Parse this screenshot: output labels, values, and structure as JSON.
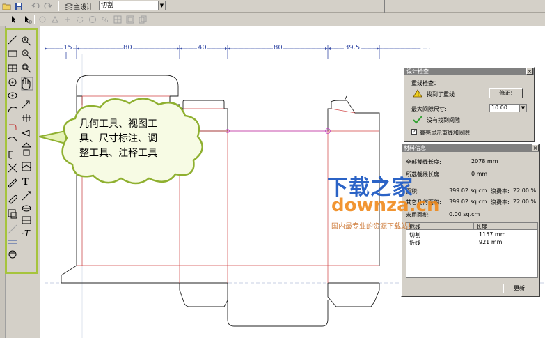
{
  "toolbar": {
    "main_design_label": "主设计",
    "layer_select_value": "切割"
  },
  "canvas": {
    "dimensions": [
      "15",
      "80",
      "40",
      "80",
      "39.5"
    ]
  },
  "callout": {
    "text": "几何工具、视图工具、尺寸标注、调整工具、注释工具",
    "lines": [
      "几何工具、视图工",
      "具、尺寸标注、调",
      "整工具、注释工具"
    ]
  },
  "design_check": {
    "title": "设计检查",
    "overlap_label": "重线检查：",
    "overlap_status": "找到了重线",
    "fix_button": "修正!",
    "max_gap_label": "最大间隙尺寸:",
    "max_gap_value": "10.00",
    "gap_status": "没有找到间隙",
    "highlight_checkbox_label": "高亮显示重线和间隙",
    "highlight_checked": true
  },
  "material_info": {
    "title": "材料信息",
    "rows": [
      {
        "label": "全部截线长度:",
        "value": "2078 mm"
      },
      {
        "label": "所选截线长度:",
        "value": "0 mm"
      },
      {
        "label": "面积:",
        "value": "399.02 sq.cm",
        "label2": "浪费率:",
        "value2": "22.00 %"
      },
      {
        "label": "其它几何面积:",
        "value": "399.02 sq.cm",
        "label2": "浪费率:",
        "value2": "22.00 %"
      },
      {
        "label": "未用面积:",
        "value": "0.00 sq.cm"
      }
    ],
    "table_headers": [
      "截线",
      "长度"
    ],
    "table_rows": [
      [
        "切割",
        "1157 mm"
      ],
      [
        "折线",
        "921 mm"
      ]
    ],
    "update_button": "更新"
  },
  "watermark": {
    "line1": "下载之家",
    "line2": "downza.cn",
    "line3": "国内最专业的资源下载站！"
  },
  "colors": {
    "toolbox_border": "#a6c43d",
    "dimension": "#3a4fa8",
    "cut_line": "#222222",
    "crease_line": "#cc3333",
    "watermark_blue": "#2b63c6",
    "watermark_orange": "#f08a1c"
  }
}
